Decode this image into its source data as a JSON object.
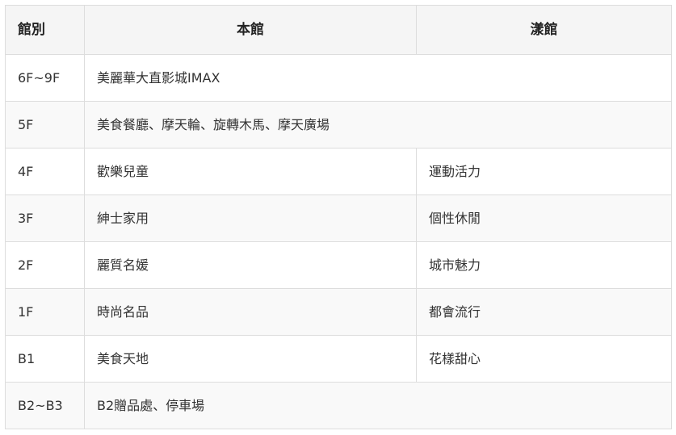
{
  "table": {
    "headers": [
      "館別",
      "本館",
      "漾館"
    ],
    "rows": [
      {
        "floor": "6F~9F",
        "main": "美麗華大直影城IMAX",
        "annex": ""
      },
      {
        "floor": "5F",
        "main": "美食餐廳、摩天輪、旋轉木馬、摩天廣場",
        "annex": ""
      },
      {
        "floor": "4F",
        "main": "歡樂兒童",
        "annex": "運動活力"
      },
      {
        "floor": "3F",
        "main": "紳士家用",
        "annex": "個性休閒"
      },
      {
        "floor": "2F",
        "main": "麗質名媛",
        "annex": "城市魅力"
      },
      {
        "floor": "1F",
        "main": "時尚名品",
        "annex": "都會流行"
      },
      {
        "floor": "B1",
        "main": "美食天地",
        "annex": "花樣甜心"
      },
      {
        "floor": "B2~B3",
        "main": "B2贈品處、停車場",
        "annex": ""
      }
    ]
  }
}
